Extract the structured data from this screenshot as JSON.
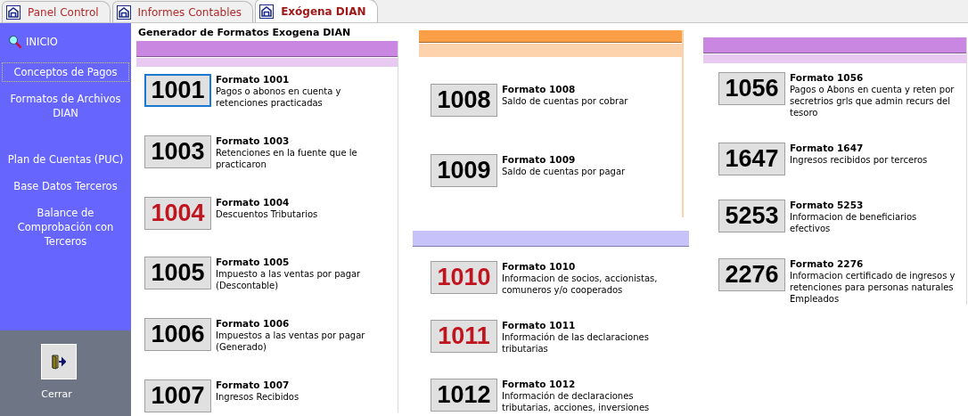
{
  "tabs": [
    {
      "label": "Panel Control",
      "selected": false
    },
    {
      "label": "Informes Contables",
      "selected": false
    },
    {
      "label": "Exógena DIAN",
      "selected": true
    }
  ],
  "sidebar": {
    "items": [
      {
        "label": "INICIO",
        "kind": "search",
        "selected": false
      },
      {
        "label": "Conceptos de Pagos",
        "kind": "link",
        "selected": true
      },
      {
        "label": "Formatos de Archivos DIAN",
        "kind": "link",
        "selected": false
      },
      {
        "label": "Plan de Cuentas (PUC)",
        "kind": "link",
        "selected": false
      },
      {
        "label": "Base Datos Terceros",
        "kind": "link",
        "selected": false
      },
      {
        "label": "Balance de Comprobación con Terceros",
        "kind": "link",
        "selected": false
      }
    ],
    "close_button": {
      "label": "Cerrar"
    }
  },
  "title": "Generador de Formatos Exogena DIAN",
  "columns": [
    {
      "sections": [
        {
          "color": "#c987e2",
          "formats": [
            {
              "code": "1001",
              "title": "Formato 1001",
              "description": "Pagos o abonos en cuenta y retenciones practicadas",
              "highlighted": false,
              "selected": true
            },
            {
              "code": "1003",
              "title": "Formato 1003",
              "description": "Retenciones en la fuente que le practicaron",
              "highlighted": false,
              "selected": false
            },
            {
              "code": "1004",
              "title": "Formato 1004",
              "description": "Descuentos Tributarios",
              "highlighted": true,
              "selected": false
            },
            {
              "code": "1005",
              "title": "Formato 1005",
              "description": "Impuesto a las ventas por pagar (Descontable)",
              "highlighted": false,
              "selected": false
            },
            {
              "code": "1006",
              "title": "Formato 1006",
              "description": "Impuestos a las ventas por pagar (Generado)",
              "highlighted": false,
              "selected": false
            },
            {
              "code": "1007",
              "title": "Formato 1007",
              "description": "Ingresos Recibidos",
              "highlighted": false,
              "selected": false
            }
          ]
        }
      ]
    },
    {
      "sections": [
        {
          "color": "#fa9e48",
          "formats": [
            {
              "code": "1008",
              "title": "Formato 1008",
              "description": "Saldo de cuentas por cobrar",
              "highlighted": false,
              "selected": false
            },
            {
              "code": "1009",
              "title": "Formato 1009",
              "description": "Saldo de cuentas por pagar",
              "highlighted": false,
              "selected": false
            }
          ]
        },
        {
          "color": "#c8c2fa",
          "formats": [
            {
              "code": "1010",
              "title": "Formato 1010",
              "description": "Informacion de socios, accionistas, comuneros y/o cooperados",
              "highlighted": true,
              "selected": false
            },
            {
              "code": "1011",
              "title": "Formato 1011",
              "description": "Información de las declaraciones tributarias",
              "highlighted": true,
              "selected": false
            },
            {
              "code": "1012",
              "title": "Formato 1012",
              "description": "Información de declaraciones tributarias, acciones, inversiones",
              "highlighted": false,
              "selected": false
            }
          ]
        }
      ]
    },
    {
      "sections": [
        {
          "color": "#c987e2",
          "formats": [
            {
              "code": "1056",
              "title": "Formato 1056",
              "description": "Pagos o Abons en cuenta y reten por secretrios grls que admin recurs del tesoro",
              "highlighted": false,
              "selected": false
            },
            {
              "code": "1647",
              "title": "Formato 1647",
              "description": "Ingresos recibidos por terceros",
              "highlighted": false,
              "selected": false
            },
            {
              "code": "5253",
              "title": "Formato 5253",
              "description": "Informacion de beneficiarios efectivos",
              "highlighted": false,
              "selected": false
            },
            {
              "code": "2276",
              "title": "Formato 2276",
              "description": "Informacion certificado de ingresos y retenciones para personas naturales Empleados",
              "highlighted": false,
              "selected": false
            }
          ]
        }
      ]
    }
  ]
}
